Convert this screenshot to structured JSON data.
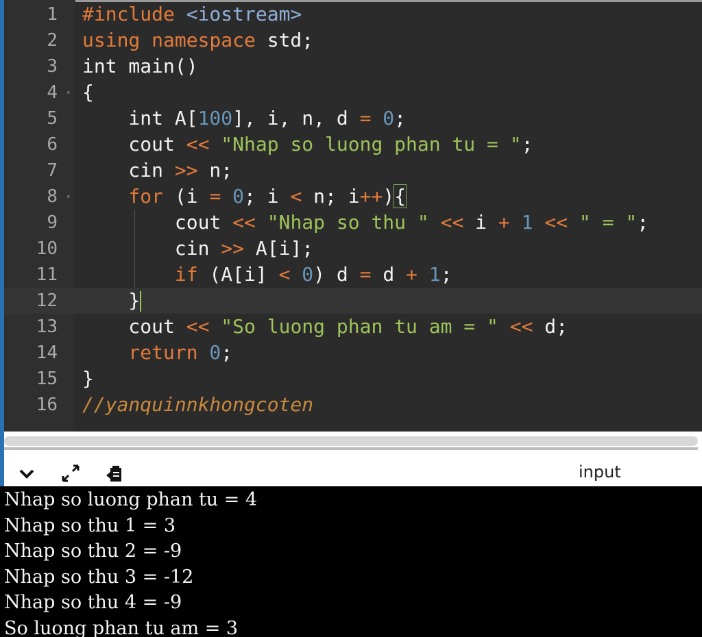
{
  "editor": {
    "lines": [
      {
        "n": "1",
        "tokens": [
          [
            "incl",
            "#include "
          ],
          [
            "hdr",
            "<iostream>"
          ]
        ]
      },
      {
        "n": "2",
        "tokens": [
          [
            "kw",
            "using namespace "
          ],
          [
            "",
            "std;"
          ]
        ]
      },
      {
        "n": "3",
        "tokens": [
          [
            "",
            "int main()"
          ]
        ]
      },
      {
        "n": "4",
        "tokens": [
          [
            "",
            "{"
          ]
        ],
        "fold": true
      },
      {
        "n": "5",
        "tokens": [
          [
            "",
            "    int A["
          ],
          [
            "num",
            "100"
          ],
          [
            "",
            "], i, n, d "
          ],
          [
            "op",
            "="
          ],
          [
            "num",
            " 0"
          ],
          [
            "",
            ";"
          ]
        ]
      },
      {
        "n": "6",
        "tokens": [
          [
            "",
            "    cout "
          ],
          [
            "op",
            "<<"
          ],
          [
            "str",
            " \"Nhap so luong phan tu = \""
          ],
          [
            "",
            ";"
          ]
        ]
      },
      {
        "n": "7",
        "tokens": [
          [
            "",
            "    cin "
          ],
          [
            "op",
            ">>"
          ],
          [
            "",
            " n;"
          ]
        ]
      },
      {
        "n": "8",
        "tokens": [
          [
            "kw",
            "    for"
          ],
          [
            "",
            " (i "
          ],
          [
            "op",
            "="
          ],
          [
            "num",
            " 0"
          ],
          [
            "",
            "; i "
          ],
          [
            "op",
            "<"
          ],
          [
            "",
            " n; i"
          ],
          [
            "op",
            "++"
          ],
          [
            "",
            ")"
          ],
          [
            "brace",
            "{"
          ]
        ],
        "fold": true
      },
      {
        "n": "9",
        "tokens": [
          [
            "",
            "        cout "
          ],
          [
            "op",
            "<<"
          ],
          [
            "str",
            " \"Nhap so thu \""
          ],
          [
            "op",
            " <<"
          ],
          [
            "",
            " i "
          ],
          [
            "op",
            "+"
          ],
          [
            "num",
            " 1"
          ],
          [
            "op",
            " <<"
          ],
          [
            "str",
            " \" = \""
          ],
          [
            "",
            ";"
          ]
        ]
      },
      {
        "n": "10",
        "tokens": [
          [
            "",
            "        cin "
          ],
          [
            "op",
            ">>"
          ],
          [
            "",
            " A[i];"
          ]
        ]
      },
      {
        "n": "11",
        "tokens": [
          [
            "kw",
            "        if"
          ],
          [
            "",
            " (A[i] "
          ],
          [
            "op",
            "<"
          ],
          [
            "num",
            " 0"
          ],
          [
            "",
            ") d "
          ],
          [
            "op",
            "="
          ],
          [
            "",
            " d "
          ],
          [
            "op",
            "+"
          ],
          [
            "num",
            " 1"
          ],
          [
            "",
            ";"
          ]
        ]
      },
      {
        "n": "12",
        "tokens": [
          [
            "",
            "    }"
          ],
          [
            "cursor",
            ""
          ]
        ],
        "active": true
      },
      {
        "n": "13",
        "tokens": [
          [
            "",
            "    cout "
          ],
          [
            "op",
            "<<"
          ],
          [
            "str",
            " \"So luong phan tu am = \""
          ],
          [
            "op",
            " <<"
          ],
          [
            "",
            " d;"
          ]
        ]
      },
      {
        "n": "14",
        "tokens": [
          [
            "kw",
            "    return"
          ],
          [
            "num",
            " 0"
          ],
          [
            "",
            ";"
          ]
        ]
      },
      {
        "n": "15",
        "tokens": [
          [
            "",
            "}"
          ]
        ]
      },
      {
        "n": "16",
        "tokens": [
          [
            "cm",
            "//yanquinnkhongcoten"
          ]
        ]
      }
    ]
  },
  "console": {
    "toolbar": {
      "collapse_icon": "chevron-down-icon",
      "expand_icon": "expand-arrows-icon",
      "clear_icon": "clipboard-icon",
      "input_label": "input"
    },
    "output_lines": [
      "Nhap so luong phan tu = 4",
      "Nhap so thu 1 = 3",
      "Nhap so thu 2 = -9",
      "Nhap so thu 3 = -12",
      "Nhap so thu 4 = -9",
      "So luong phan tu am = 3"
    ]
  }
}
